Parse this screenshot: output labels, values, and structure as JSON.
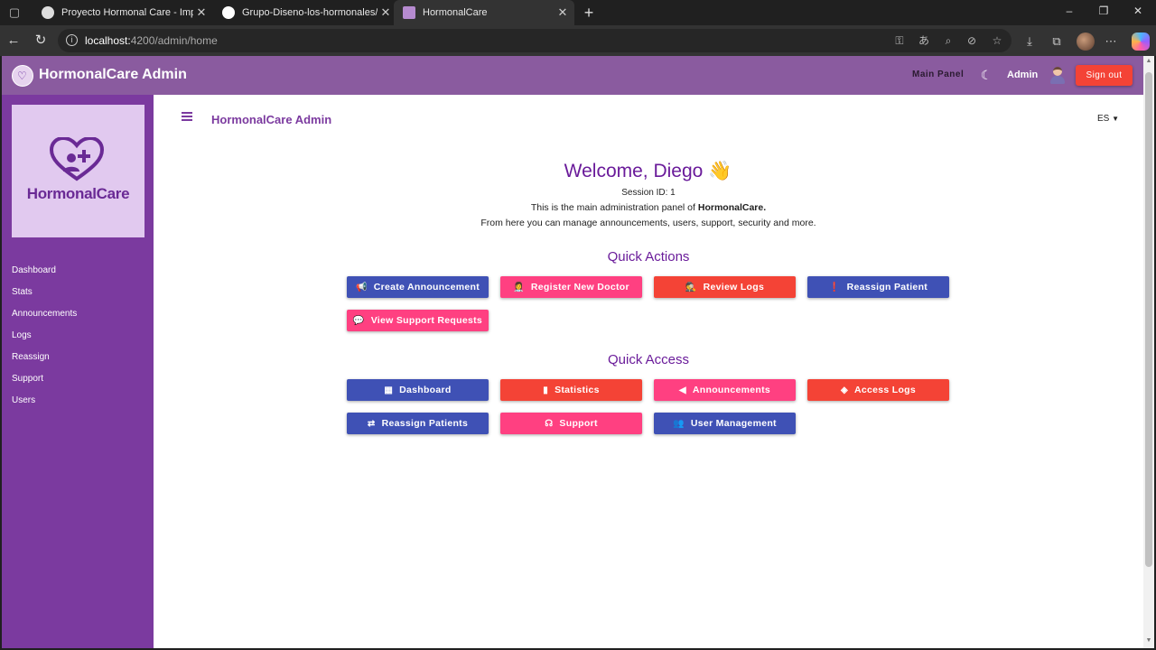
{
  "browser": {
    "tabs": [
      {
        "title": "Proyecto Hormonal Care - Implen",
        "active": false
      },
      {
        "title": "Grupo-Diseno-los-hormonales/e",
        "active": false
      },
      {
        "title": "HormonalCare",
        "active": true
      }
    ],
    "new_tab": "+",
    "url_host": "localhost:",
    "url_path": "4200/admin/home"
  },
  "topbar": {
    "title": "HormonalCare Admin",
    "main_panel": "Main Panel",
    "user": "Admin",
    "sign_out": "Sign out"
  },
  "sidebar": {
    "brand": "HormonalCare",
    "items": [
      "Dashboard",
      "Stats",
      "Announcements",
      "Logs",
      "Reassign",
      "Support",
      "Users"
    ]
  },
  "subheader": {
    "title": "HormonalCare Admin",
    "language": "ES"
  },
  "welcome": {
    "heading": "Welcome, Diego 👋",
    "session": "Session ID: 1",
    "line1_prefix": "This is the main administration panel of ",
    "line1_brand": "HormonalCare.",
    "line2": "From here you can manage announcements, users, support, security and more."
  },
  "quick_actions": {
    "title": "Quick Actions",
    "buttons": [
      {
        "label": "Create Announcement",
        "icon": "📢",
        "color": "#3f51b5"
      },
      {
        "label": "Register New Doctor",
        "icon": "👩‍⚕️",
        "color": "#ff4081"
      },
      {
        "label": "Review Logs",
        "icon": "🕵️",
        "color": "#f44336"
      },
      {
        "label": "Reassign Patient",
        "icon": "❗",
        "color": "#3f51b5"
      },
      {
        "label": "View Support Requests",
        "icon": "💬",
        "color": "#ff4081"
      }
    ]
  },
  "quick_access": {
    "title": "Quick Access",
    "buttons": [
      {
        "label": "Dashboard",
        "icon": "dashboard-icon",
        "color": "#3f51b5"
      },
      {
        "label": "Statistics",
        "icon": "bar-chart-icon",
        "color": "#f44336"
      },
      {
        "label": "Announcements",
        "icon": "megaphone-icon",
        "color": "#ff4081"
      },
      {
        "label": "Access Logs",
        "icon": "shield-icon",
        "color": "#f44336"
      },
      {
        "label": "Reassign Patients",
        "icon": "swap-icon",
        "color": "#3f51b5"
      },
      {
        "label": "Support",
        "icon": "headset-icon",
        "color": "#ff4081"
      },
      {
        "label": "User Management",
        "icon": "people-icon",
        "color": "#3f51b5"
      }
    ]
  }
}
